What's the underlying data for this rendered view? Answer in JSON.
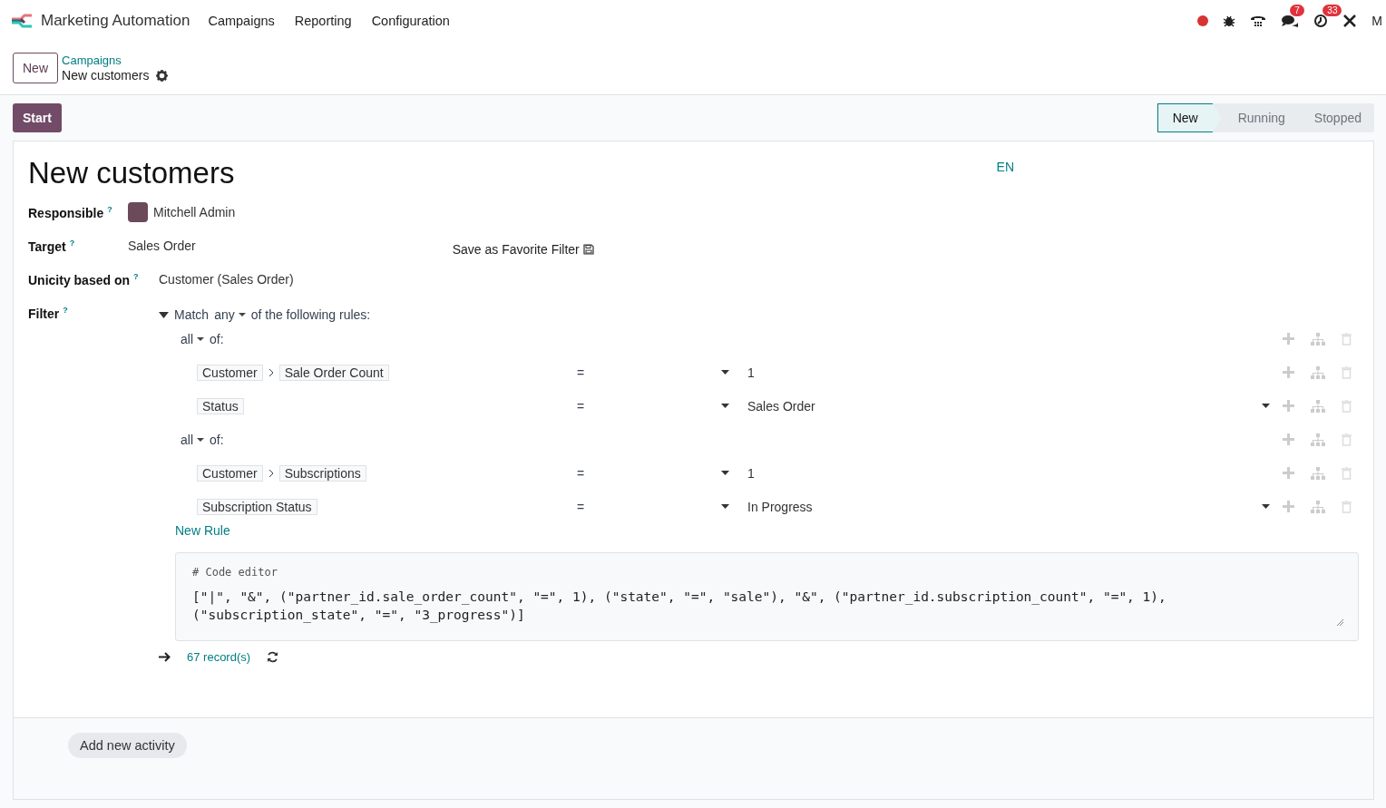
{
  "navbar": {
    "app_name": "Marketing Automation",
    "menu": [
      "Campaigns",
      "Reporting",
      "Configuration"
    ],
    "messages_badge": "7",
    "activities_badge": "33",
    "user_cut": "M"
  },
  "control_panel": {
    "new_button": "New",
    "breadcrumb_parent": "Campaigns",
    "breadcrumb_current": "New customers"
  },
  "start_button": "Start",
  "stages": [
    {
      "label": "New",
      "selected": true
    },
    {
      "label": "Running",
      "selected": false
    },
    {
      "label": "Stopped",
      "selected": false
    }
  ],
  "form": {
    "title": "New customers",
    "language": "EN",
    "fields": [
      {
        "label": "Responsible",
        "help": "?",
        "value": "Mitchell Admin",
        "kind": "user"
      },
      {
        "label": "Target",
        "help": "?",
        "value": "Sales Order",
        "kind": "text"
      },
      {
        "label": "Unicity based on",
        "help": "?",
        "value": "Customer (Sales Order)",
        "kind": "text"
      },
      {
        "label": "Filter",
        "help": "?",
        "kind": "filter"
      }
    ],
    "save_favorite": "Save as Favorite Filter",
    "domain": {
      "match_prefix": "Match",
      "match_mode": "any",
      "match_suffix": "of the following rules:",
      "groups": [
        {
          "mode": "all",
          "suffix": "of:",
          "rules": [
            {
              "path": [
                "Customer",
                "Sale Order Count"
              ],
              "operator": "=",
              "value": "1",
              "value_dropdown": false
            },
            {
              "path": [
                "Status"
              ],
              "operator": "=",
              "value": "Sales Order",
              "value_dropdown": true
            }
          ]
        },
        {
          "mode": "all",
          "suffix": "of:",
          "rules": [
            {
              "path": [
                "Customer",
                "Subscriptions"
              ],
              "operator": "=",
              "value": "1",
              "value_dropdown": false
            },
            {
              "path": [
                "Subscription Status"
              ],
              "operator": "=",
              "value": "In Progress",
              "value_dropdown": true
            }
          ]
        }
      ],
      "new_rule": "New Rule",
      "code_comment": "# Code editor",
      "code": "[\"|\", \"&\", (\"partner_id.sale_order_count\", \"=\", 1), (\"state\", \"=\", \"sale\"), \"&\", (\"partner_id.subscription_count\", \"=\", 1), (\"subscription_state\", \"=\", \"3_progress\")]",
      "records": "67 record(s)"
    }
  },
  "add_activity": "Add new activity"
}
